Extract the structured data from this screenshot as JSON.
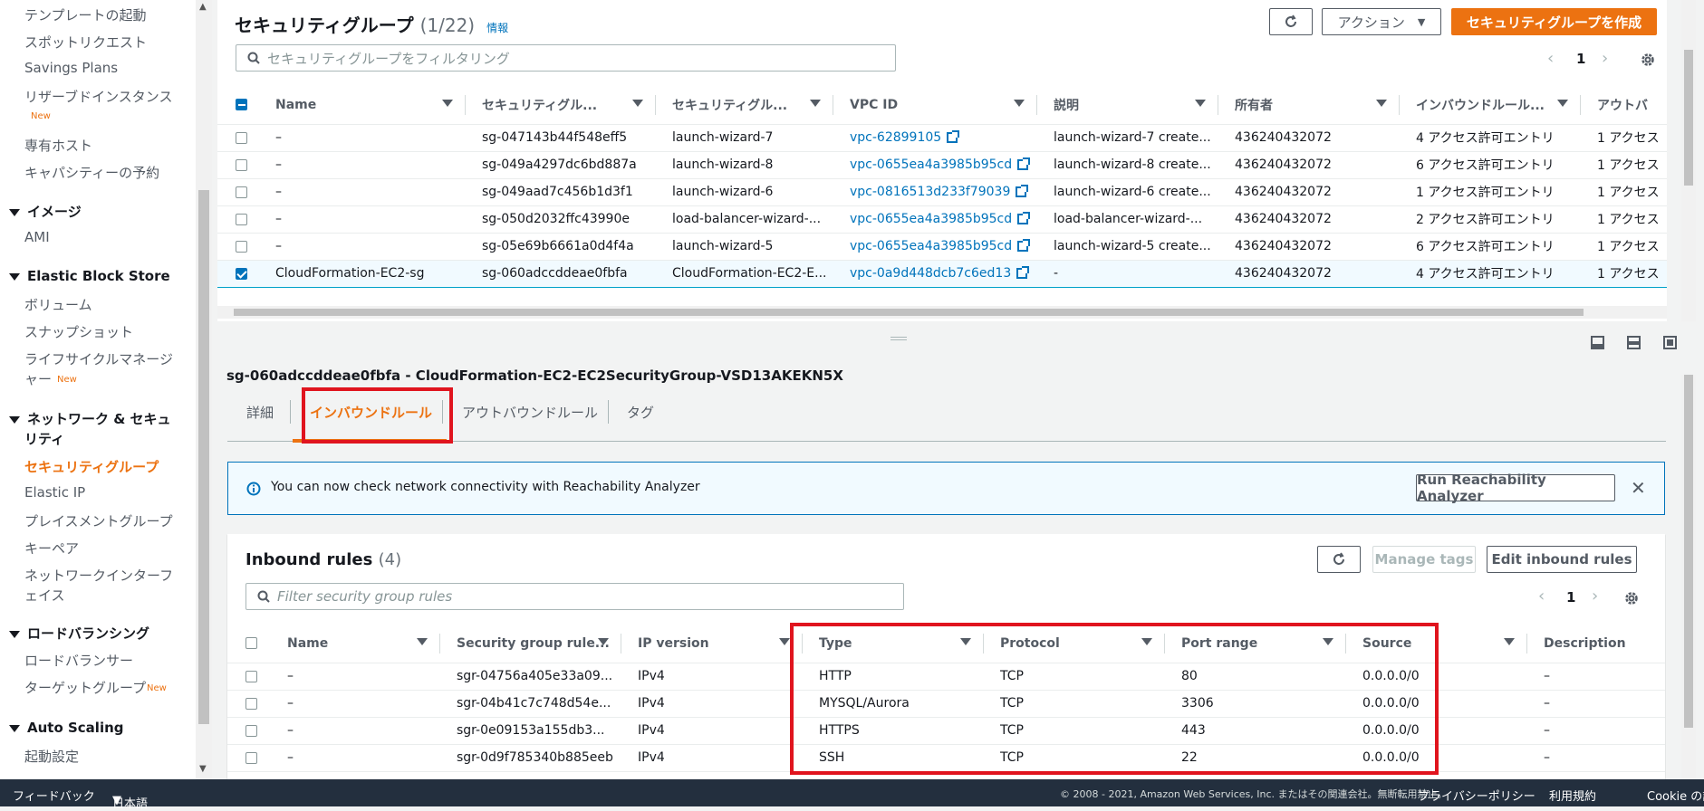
{
  "sidebar": {
    "items_top": [
      {
        "label": "テンプレートの起動"
      },
      {
        "label": "スポットリクエスト"
      },
      {
        "label": "Savings Plans"
      },
      {
        "label": "リザーブドインスタンス"
      },
      {
        "label": "専有ホスト"
      },
      {
        "label": "キャパシティーの予約"
      }
    ],
    "new_badge": "New",
    "section_images": "イメージ",
    "ami": "AMI",
    "section_ebs": "Elastic Block Store",
    "volumes": "ボリューム",
    "snapshots": "スナップショット",
    "lifecycle_1": "ライフサイクルマネージ",
    "lifecycle_2": "ャー",
    "section_network_1": "ネットワーク & セキュ",
    "section_network_2": "リティ",
    "security_groups": "セキュリティグループ",
    "elastic_ip": "Elastic IP",
    "placement": "プレイスメントグループ",
    "keypair": "キーペア",
    "eni_1": "ネットワークインターフ",
    "eni_2": "ェイス",
    "section_lb": "ロードバランシング",
    "load_balancers": "ロードバランサー",
    "target_groups": "ターゲットグループ",
    "section_autoscaling": "Auto Scaling",
    "launch_config": "起動設定"
  },
  "top": {
    "title": "セキュリティグループ",
    "count": "(1/22)",
    "info": "情報",
    "actions": "アクション",
    "create": "セキュリティグループを作成",
    "filter_placeholder": "セキュリティグループをフィルタリング",
    "page": "1",
    "columns": [
      "Name",
      "セキュリティグル...",
      "セキュリティグル...",
      "VPC ID",
      "説明",
      "所有者",
      "インバウンドルール...",
      "アウトバ"
    ],
    "rows": [
      {
        "name": "–",
        "sgid": "sg-047143b44f548eff5",
        "sgname": "launch-wizard-7",
        "vpc": "vpc-62899105",
        "desc": "launch-wizard-7 create...",
        "owner": "436240432072",
        "inbound": "4 アクセス許可エントリ",
        "outbound": "1 アクセス",
        "selected": false
      },
      {
        "name": "–",
        "sgid": "sg-049a4297dc6bd887a",
        "sgname": "launch-wizard-8",
        "vpc": "vpc-0655ea4a3985b95cd",
        "desc": "launch-wizard-8 create...",
        "owner": "436240432072",
        "inbound": "6 アクセス許可エントリ",
        "outbound": "1 アクセス",
        "selected": false
      },
      {
        "name": "–",
        "sgid": "sg-049aad7c456b1d3f1",
        "sgname": "launch-wizard-6",
        "vpc": "vpc-0816513d233f79039",
        "desc": "launch-wizard-6 create...",
        "owner": "436240432072",
        "inbound": "1 アクセス許可エントリ",
        "outbound": "1 アクセス",
        "selected": false
      },
      {
        "name": "–",
        "sgid": "sg-050d2032ffc43990e",
        "sgname": "load-balancer-wizard-...",
        "vpc": "vpc-0655ea4a3985b95cd",
        "desc": "load-balancer-wizard-...",
        "owner": "436240432072",
        "inbound": "2 アクセス許可エントリ",
        "outbound": "1 アクセス",
        "selected": false
      },
      {
        "name": "–",
        "sgid": "sg-05e69b6661a0d4f4a",
        "sgname": "launch-wizard-5",
        "vpc": "vpc-0655ea4a3985b95cd",
        "desc": "launch-wizard-5 create...",
        "owner": "436240432072",
        "inbound": "6 アクセス許可エントリ",
        "outbound": "1 アクセス",
        "selected": false
      },
      {
        "name": "CloudFormation-EC2-sg",
        "sgid": "sg-060adccddeae0fbfa",
        "sgname": "CloudFormation-EC2-E...",
        "vpc": "vpc-0a9d448dcb7c6ed13",
        "desc": "-",
        "owner": "436240432072",
        "inbound": "4 アクセス許可エントリ",
        "outbound": "1 アクセス",
        "selected": true
      }
    ]
  },
  "detail": {
    "heading": "sg-060adccddeae0fbfa - CloudFormation-EC2-EC2SecurityGroup-VSD13AKEKN5X",
    "tabs": [
      "詳細",
      "インバウンドルール",
      "アウトバウンドルール",
      "タグ"
    ],
    "info_text": "You can now check network connectivity with Reachability Analyzer",
    "analyzer_button": "Run Reachability Analyzer",
    "rules_title": "Inbound rules",
    "rules_count": "(4)",
    "manage_tags": "Manage tags",
    "edit_rules": "Edit inbound rules",
    "filter_placeholder": "Filter security group rules",
    "page": "1",
    "columns": [
      "Name",
      "Security group rule...",
      "IP version",
      "Type",
      "Protocol",
      "Port range",
      "Source",
      "Description"
    ],
    "rules": [
      {
        "name": "–",
        "rule": "sgr-04756a405e33a09...",
        "ip": "IPv4",
        "type": "HTTP",
        "protocol": "TCP",
        "port": "80",
        "source": "0.0.0.0/0",
        "desc": "–"
      },
      {
        "name": "–",
        "rule": "sgr-04b41c7c748d54e...",
        "ip": "IPv4",
        "type": "MYSQL/Aurora",
        "protocol": "TCP",
        "port": "3306",
        "source": "0.0.0.0/0",
        "desc": "–"
      },
      {
        "name": "–",
        "rule": "sgr-0e09153a155db3...",
        "ip": "IPv4",
        "type": "HTTPS",
        "protocol": "TCP",
        "port": "443",
        "source": "0.0.0.0/0",
        "desc": "–"
      },
      {
        "name": "–",
        "rule": "sgr-0d9f785340b885eeb",
        "ip": "IPv4",
        "type": "SSH",
        "protocol": "TCP",
        "port": "22",
        "source": "0.0.0.0/0",
        "desc": "–"
      }
    ]
  },
  "footer": {
    "feedback": "フィードバック",
    "language": "日本語",
    "copyright": "© 2008 - 2021, Amazon Web Services, Inc. またはその関連会社。無断転用禁止。",
    "privacy": "プライバシーポリシー",
    "terms": "利用規約",
    "cookie": "Cookie の設"
  },
  "colors": {
    "accent": "#ec7211",
    "link": "#0073bb",
    "highlight": "#e0141e"
  }
}
